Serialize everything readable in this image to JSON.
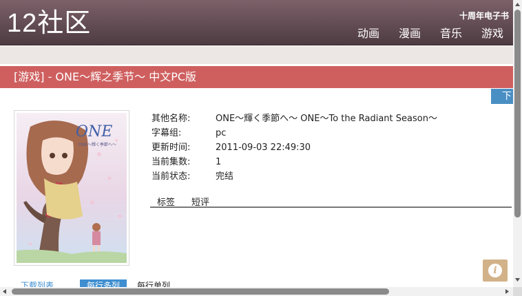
{
  "header": {
    "logo": "12社区",
    "anniversary": "十周年电子书",
    "nav": [
      "动画",
      "漫画",
      "音乐",
      "游戏"
    ]
  },
  "title": "[游戏] - ONE～辉之季节～ 中文PC版",
  "download_tab": "下",
  "info": [
    {
      "label": "其他名称:",
      "value": "ONE～輝く季節へ～ ONE～To the Radiant Season～"
    },
    {
      "label": "字幕组:",
      "value": "pc"
    },
    {
      "label": "更新时间:",
      "value": "2011-09-03 22:49:30"
    },
    {
      "label": "当前集数:",
      "value": "1"
    },
    {
      "label": "当前状态:",
      "value": "完结"
    }
  ],
  "tabs": [
    "标签",
    "短评"
  ],
  "bottom_tabs": [
    "下载列表",
    "每行多列",
    "每行单列"
  ],
  "colors": {
    "header": "#5e4a51",
    "title_bar": "#cf5f5f",
    "accent_blue": "#4a8fc4",
    "info_button": "#d2b288"
  },
  "icons": {
    "info": "info-icon"
  }
}
